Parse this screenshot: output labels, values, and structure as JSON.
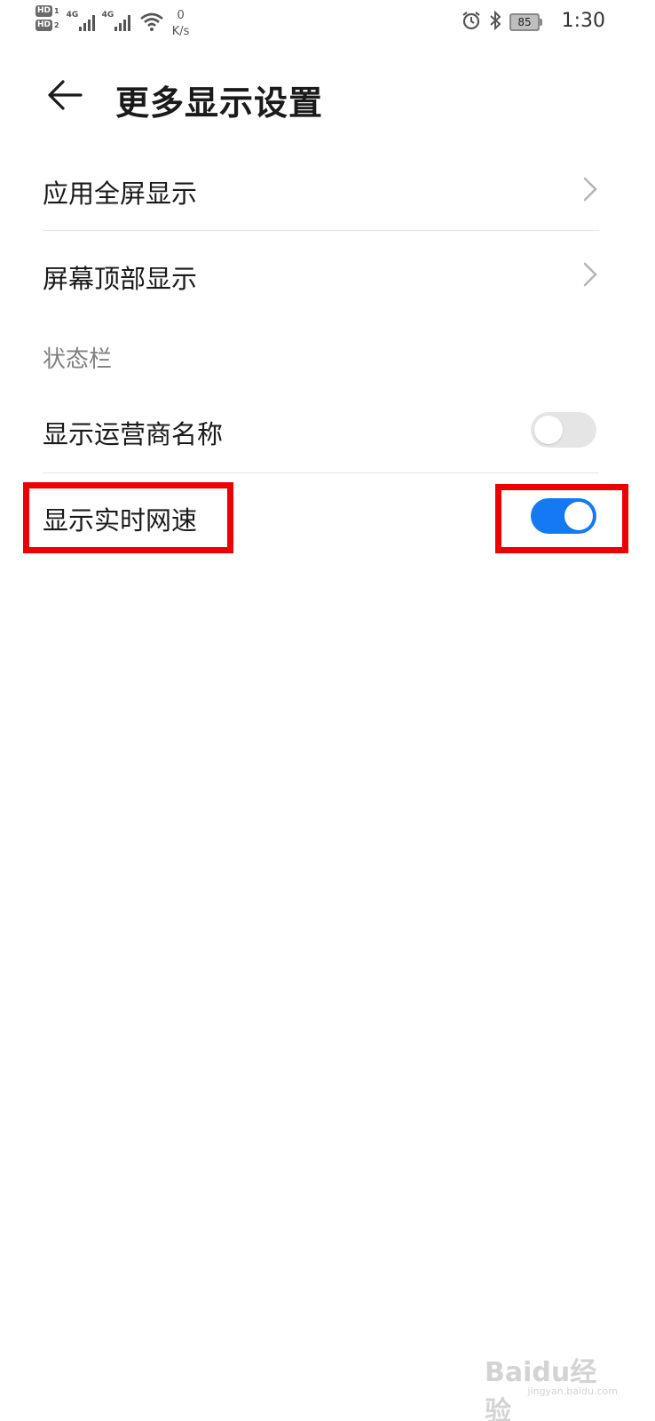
{
  "status_bar": {
    "hd1": "HD",
    "hd1_sim": "1",
    "hd2": "HD",
    "hd2_sim": "2",
    "sim1_network": "4G",
    "sim2_network": "4G",
    "net_speed_value": "0",
    "net_speed_unit": "K/s",
    "battery_level": "85",
    "time": "1:30",
    "icons": [
      "hd-icon",
      "signal-icon",
      "wifi-icon",
      "alarm-icon",
      "bluetooth-icon",
      "battery-icon"
    ]
  },
  "header": {
    "title": "更多显示设置",
    "back_icon": "arrow-left-icon"
  },
  "menu": {
    "items": [
      {
        "label": "应用全屏显示",
        "icon": "chevron-right-icon"
      },
      {
        "label": "屏幕顶部显示",
        "icon": "chevron-right-icon"
      }
    ]
  },
  "status_section": {
    "title": "状态栏",
    "toggles": [
      {
        "label": "显示运营商名称",
        "enabled": false
      },
      {
        "label": "显示实时网速",
        "enabled": true
      }
    ]
  },
  "colors": {
    "toggle_on": "#1479f2",
    "toggle_off": "#e5e5e5",
    "highlight": "#ee0000"
  },
  "watermark": {
    "text": "Baidu经验",
    "sub": "jingyan.baidu.com"
  }
}
